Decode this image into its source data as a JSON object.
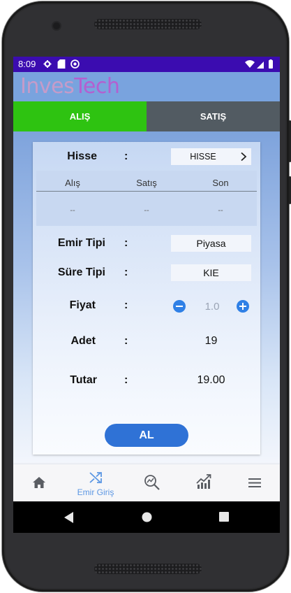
{
  "status_bar": {
    "time": "8:09"
  },
  "app": {
    "logo_part1": "Inves",
    "logo_part2": "Tech"
  },
  "tabs": [
    {
      "label": "ALIŞ",
      "active": true,
      "color": "#2ec311"
    },
    {
      "label": "SATIŞ",
      "active": false,
      "color": "#525b62"
    }
  ],
  "form": {
    "hisse": {
      "label": "Hisse",
      "colon": ":",
      "value": "HISSE"
    },
    "quote": {
      "headers": [
        "Alış",
        "Satış",
        "Son"
      ],
      "values": [
        "--",
        "--",
        "--"
      ]
    },
    "emir_tipi": {
      "label": "Emir Tipi",
      "colon": ":",
      "value": "Piyasa"
    },
    "sure_tipi": {
      "label": "Süre Tipi",
      "colon": ":",
      "value": "KIE"
    },
    "fiyat": {
      "label": "Fiyat",
      "colon": ":",
      "value": "1.0"
    },
    "adet": {
      "label": "Adet",
      "colon": ":",
      "value": "19"
    },
    "tutar": {
      "label": "Tutar",
      "colon": ":",
      "value": "19.00"
    },
    "submit_label": "AL"
  },
  "bottom_nav": {
    "items": [
      {
        "icon": "home-icon",
        "label": ""
      },
      {
        "icon": "shuffle-icon",
        "label": "Emir Giriş",
        "active": true
      },
      {
        "icon": "search-chart-icon",
        "label": ""
      },
      {
        "icon": "trending-up-icon",
        "label": ""
      },
      {
        "icon": "menu-icon",
        "label": ""
      }
    ]
  },
  "colors": {
    "status_bar": "#3b0cb0",
    "accent": "#2f72d6",
    "buy_tab": "#2ec311",
    "sell_tab": "#525b62"
  }
}
